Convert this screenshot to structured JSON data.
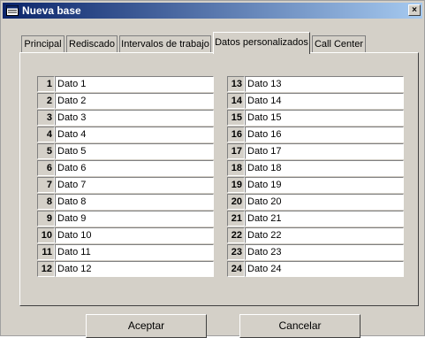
{
  "window": {
    "title": "Nueva base",
    "close_glyph": "×"
  },
  "tabs": [
    {
      "label": "Principal",
      "active": false
    },
    {
      "label": "Rediscado",
      "active": false
    },
    {
      "label": "Intervalos de trabajo",
      "active": false
    },
    {
      "label": "Datos personalizados",
      "active": true
    },
    {
      "label": "Call Center",
      "active": false
    }
  ],
  "fields_left": [
    {
      "num": "1",
      "value": "Dato 1"
    },
    {
      "num": "2",
      "value": "Dato 2"
    },
    {
      "num": "3",
      "value": "Dato 3"
    },
    {
      "num": "4",
      "value": "Dato 4"
    },
    {
      "num": "5",
      "value": "Dato 5"
    },
    {
      "num": "6",
      "value": "Dato 6"
    },
    {
      "num": "7",
      "value": "Dato 7"
    },
    {
      "num": "8",
      "value": "Dato 8"
    },
    {
      "num": "9",
      "value": "Dato 9"
    },
    {
      "num": "10",
      "value": "Dato 10"
    },
    {
      "num": "11",
      "value": "Dato 11"
    },
    {
      "num": "12",
      "value": "Dato 12"
    }
  ],
  "fields_right": [
    {
      "num": "13",
      "value": "Dato 13"
    },
    {
      "num": "14",
      "value": "Dato 14"
    },
    {
      "num": "15",
      "value": "Dato 15"
    },
    {
      "num": "16",
      "value": "Dato 16"
    },
    {
      "num": "17",
      "value": "Dato 17"
    },
    {
      "num": "18",
      "value": "Dato 18"
    },
    {
      "num": "19",
      "value": "Dato 19"
    },
    {
      "num": "20",
      "value": "Dato 20"
    },
    {
      "num": "21",
      "value": "Dato 21"
    },
    {
      "num": "22",
      "value": "Dato 22"
    },
    {
      "num": "23",
      "value": "Dato 23"
    },
    {
      "num": "24",
      "value": "Dato 24"
    }
  ],
  "buttons": {
    "accept": "Aceptar",
    "cancel": "Cancelar"
  }
}
